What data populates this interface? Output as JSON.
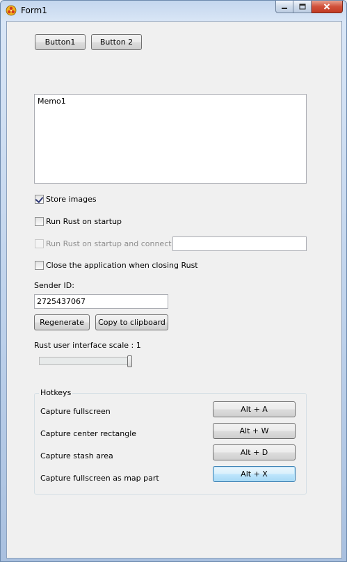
{
  "window": {
    "title": "Form1"
  },
  "toolbar": {
    "button1_label": "Button1",
    "button2_label": "Button 2"
  },
  "memo": {
    "value": "Memo1"
  },
  "options": {
    "store_images": {
      "label": "Store images",
      "checked": true
    },
    "run_on_startup": {
      "label": "Run Rust on startup",
      "checked": false
    },
    "run_and_connect": {
      "label": "Run Rust on startup and connect to :",
      "checked": false,
      "enabled": false,
      "value": ""
    },
    "close_app": {
      "label": "Close the application when closing Rust",
      "checked": false
    }
  },
  "sender": {
    "label": "Sender ID:",
    "value": "2725437067",
    "regenerate_label": "Regenerate",
    "copy_label": "Copy to clipboard"
  },
  "scale": {
    "label": "Rust user interface scale : 1",
    "level": 1.0
  },
  "hotkeys": {
    "title": "Hotkeys",
    "rows": [
      {
        "label": "Capture fullscreen",
        "key": "Alt + A"
      },
      {
        "label": "Capture center rectangle",
        "key": "Alt + W"
      },
      {
        "label": "Capture stash area",
        "key": "Alt + D"
      },
      {
        "label": "Capture fullscreen as map part",
        "key": "Alt + X"
      }
    ]
  },
  "colors": {
    "titlebar": "#c4d6ee",
    "client_bg": "#f0f0f0",
    "focus_button": "#bee6fd",
    "close_button": "#c23b24"
  }
}
